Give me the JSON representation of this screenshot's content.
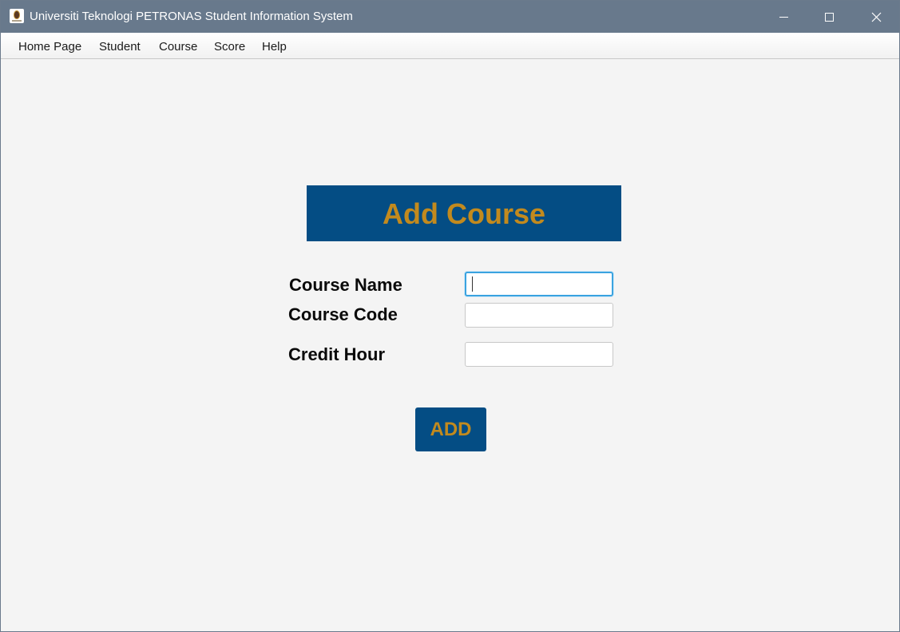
{
  "window": {
    "title": "Universiti Teknologi PETRONAS Student Information System",
    "controls": [
      "minimize-icon",
      "maximize-icon",
      "close-icon"
    ]
  },
  "menu": {
    "items": [
      {
        "label": "Home Page"
      },
      {
        "label": "Student"
      },
      {
        "label": "Course"
      },
      {
        "label": "Score"
      },
      {
        "label": "Help"
      }
    ]
  },
  "form": {
    "heading": "Add Course",
    "fields": [
      {
        "label": "Course Name",
        "value": "",
        "placeholder": ""
      },
      {
        "label": "Course Code",
        "value": "",
        "placeholder": ""
      },
      {
        "label": "Credit Hour",
        "value": "",
        "placeholder": ""
      }
    ],
    "submit_label": "ADD"
  },
  "colors": {
    "titlebar": "#68798c",
    "banner": "#044d84",
    "accent_text": "#c28a1e",
    "focus_border": "#3aa3e0",
    "background": "#f4f4f4"
  }
}
